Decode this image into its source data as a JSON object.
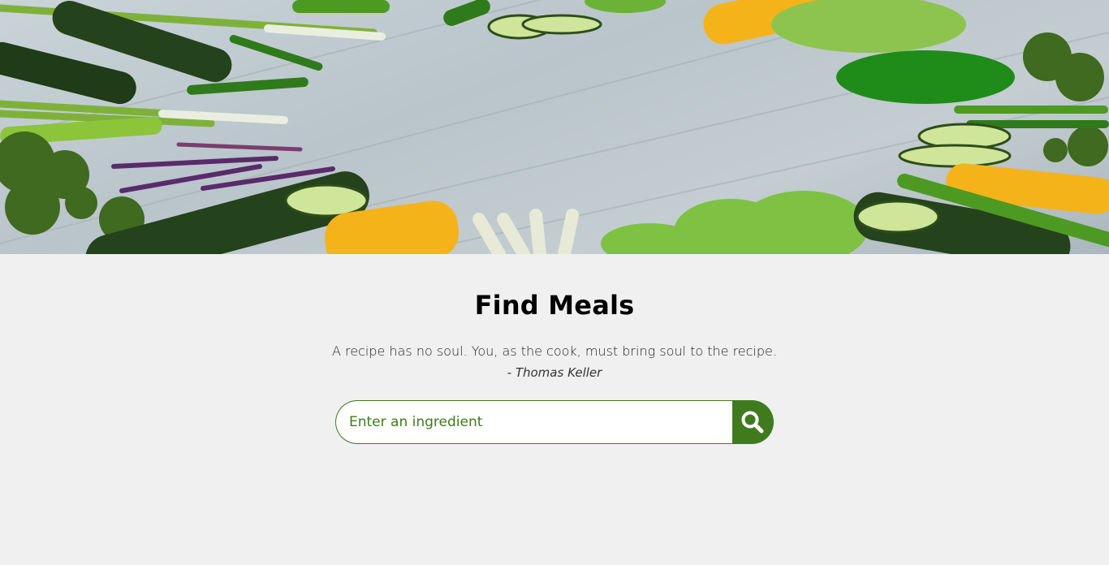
{
  "hero": {
    "image": "vegetables-on-wooden-table",
    "colors": {
      "wood": "#c3ccd1",
      "vegetable_green": "#3f8a1c",
      "corn": "#f5b31a"
    }
  },
  "main": {
    "title": "Find Meals",
    "quote": "A recipe has no soul. You, as the cook, must bring soul to the recipe.",
    "author": "- Thomas Keller"
  },
  "search": {
    "placeholder": "Enter an ingredient",
    "value": "",
    "button_icon": "search-icon",
    "accent_color": "#3f7a1d"
  }
}
